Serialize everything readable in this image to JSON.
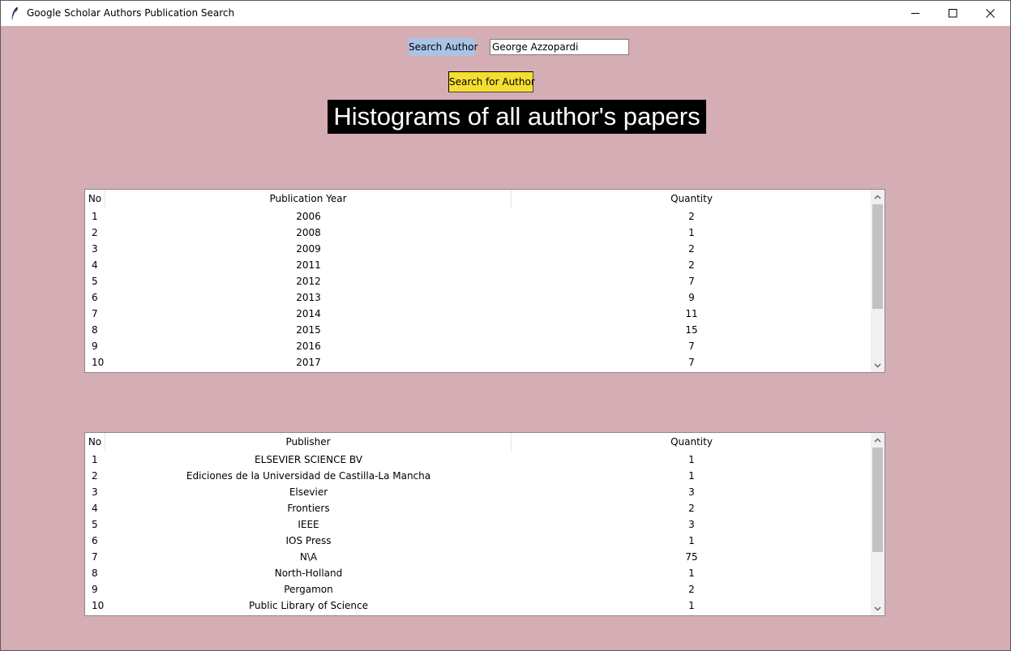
{
  "window": {
    "title": "Google Scholar Authors Publication Search",
    "icon": "feather-icon"
  },
  "search": {
    "label": "Search Author",
    "value": "George Azzopardi",
    "button_label": "Search for Author"
  },
  "heading": "Histograms of all author's papers",
  "year_table": {
    "headers": [
      "No",
      "Publication Year",
      "Quantity"
    ],
    "rows": [
      [
        "1",
        "2006",
        "2"
      ],
      [
        "2",
        "2008",
        "1"
      ],
      [
        "3",
        "2009",
        "2"
      ],
      [
        "4",
        "2011",
        "2"
      ],
      [
        "5",
        "2012",
        "7"
      ],
      [
        "6",
        "2013",
        "9"
      ],
      [
        "7",
        "2014",
        "11"
      ],
      [
        "8",
        "2015",
        "15"
      ],
      [
        "9",
        "2016",
        "7"
      ],
      [
        "10",
        "2017",
        "7"
      ]
    ]
  },
  "publisher_table": {
    "headers": [
      "No",
      "Publisher",
      "Quantity"
    ],
    "rows": [
      [
        "1",
        "ELSEVIER SCIENCE BV",
        "1"
      ],
      [
        "2",
        "Ediciones de la Universidad de Castilla-La Mancha",
        "1"
      ],
      [
        "3",
        "Elsevier",
        "3"
      ],
      [
        "4",
        "Frontiers",
        "2"
      ],
      [
        "5",
        "IEEE",
        "3"
      ],
      [
        "6",
        "IOS Press",
        "1"
      ],
      [
        "7",
        "N\\A",
        "75"
      ],
      [
        "8",
        "North-Holland",
        "1"
      ],
      [
        "9",
        "Pergamon",
        "2"
      ],
      [
        "10",
        "Public Library of Science",
        "1"
      ]
    ]
  },
  "colors": {
    "background": "#d5adb5",
    "label_bg": "#a9c4e6",
    "button_bg": "#f5de32",
    "heading_bg": "#000000",
    "heading_fg": "#ffffff"
  }
}
